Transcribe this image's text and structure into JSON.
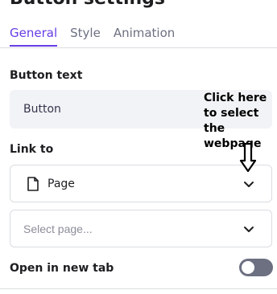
{
  "panel": {
    "title": "Button settings"
  },
  "tabs": [
    {
      "label": "General",
      "active": true
    },
    {
      "label": "Style",
      "active": false
    },
    {
      "label": "Animation",
      "active": false
    }
  ],
  "button_text": {
    "label": "Button text",
    "value": "Button"
  },
  "link_to": {
    "label": "Link to",
    "type_select": {
      "value": "Page",
      "icon": "page-icon"
    },
    "page_select": {
      "placeholder": "Select page..."
    }
  },
  "open_new_tab": {
    "label": "Open in new tab",
    "enabled": false
  },
  "annotation": {
    "text": "Click here to select the webpage"
  },
  "colors": {
    "accent": "#673de6",
    "toggle_off": "#6d7081",
    "input_bg": "#f2f3f6"
  }
}
